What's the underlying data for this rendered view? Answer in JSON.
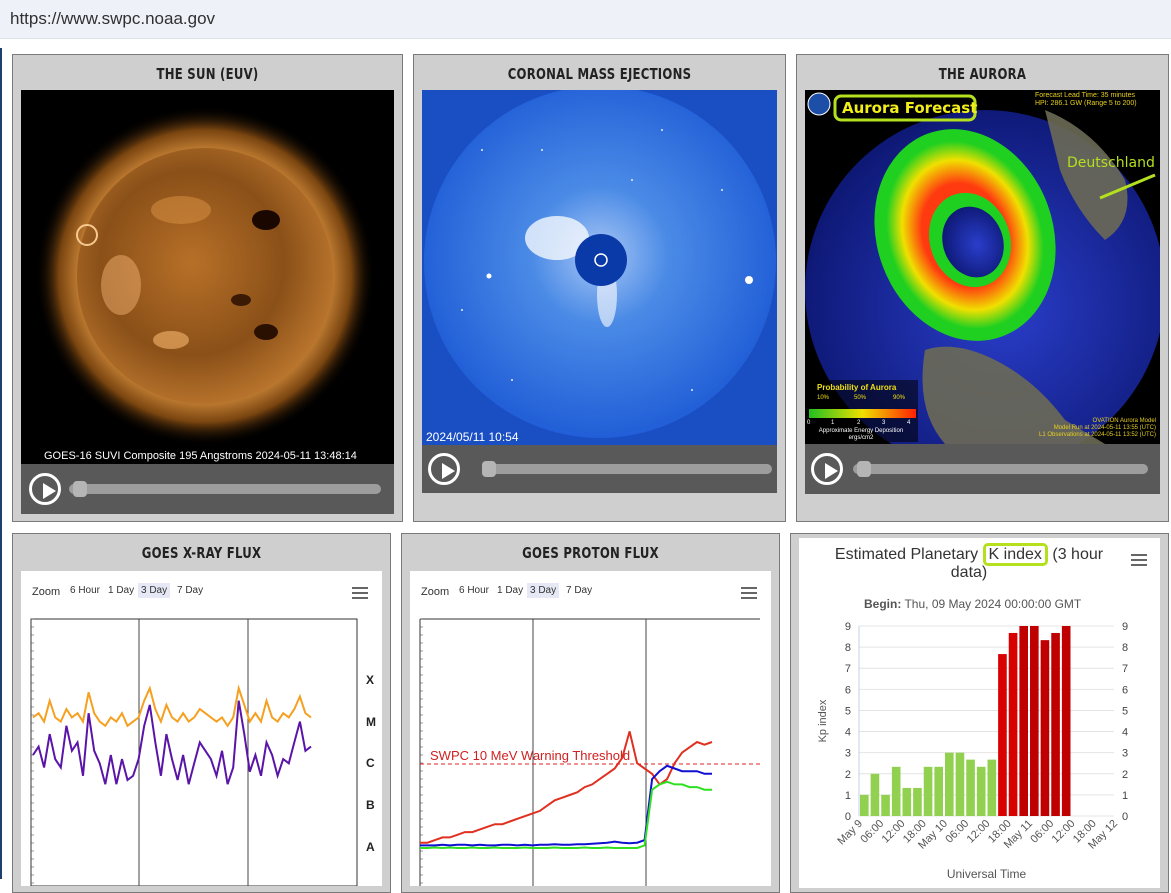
{
  "browser": {
    "url": "https://www.swpc.noaa.gov"
  },
  "panels": {
    "sun": {
      "title": "THE SUN (EUV)",
      "caption": "GOES-16 SUVI Composite 195 Angstroms 2024-05-11 13:48:14",
      "play_icon": "play-icon"
    },
    "cme": {
      "title": "CORONAL MASS EJECTIONS",
      "caption": "2024/05/11  10:54",
      "play_icon": "play-icon"
    },
    "aurora": {
      "title": "THE AURORA",
      "badge": "Aurora Forecast",
      "forecast_info": "Forecast Lead Time:  35 minutes",
      "hpi_info": "HPI: 286.1 GW (Range 5 to 200)",
      "country_label": "Deutschland",
      "legend_title": "Probability of Aurora",
      "legend_ticks": [
        "10%",
        "50%",
        "90%"
      ],
      "legend_scale": [
        "0",
        "1",
        "2",
        "3",
        "4"
      ],
      "legend_units": "Approximate Energy Deposition ergs/cm2",
      "model_info": "OVATION Aurora Model",
      "model_run": "Model Run at 2024-05-11 13:55 (UTC)",
      "obs_info": "L1 Observations at 2024-05-11 13:52 (UTC)",
      "play_icon": "play-icon"
    },
    "xray": {
      "title": "GOES X-RAY FLUX",
      "zoom_label": "Zoom",
      "zoom_options": [
        "6 Hour",
        "1 Day",
        "3 Day",
        "7 Day"
      ],
      "selected_zoom": "3 Day",
      "menu_icon": "hamburger-menu-icon",
      "class_labels": [
        "X",
        "M",
        "C",
        "B",
        "A"
      ]
    },
    "proton": {
      "title": "GOES PROTON FLUX",
      "zoom_label": "Zoom",
      "zoom_options": [
        "6 Hour",
        "1 Day",
        "3 Day",
        "7 Day"
      ],
      "selected_zoom": "3 Day",
      "menu_icon": "hamburger-menu-icon",
      "threshold_label": "SWPC 10 MeV Warning Threshold"
    },
    "kp": {
      "title_a": "Estimated Planetary",
      "title_b": "K index",
      "title_c": "(3 hour",
      "title_d": "data)",
      "menu_icon": "hamburger-menu-icon",
      "begin_label": "Begin:",
      "begin_value": "Thu, 09 May 2024 00:00:00 GMT"
    }
  },
  "chart_data": [
    {
      "type": "bar",
      "title": "Estimated Planetary K index (3 hour data)",
      "xlabel": "Universal Time",
      "ylabel": "Kp index",
      "ylim": [
        0,
        9
      ],
      "yticks": [
        "0",
        "1",
        "2",
        "3",
        "4",
        "5",
        "6",
        "7",
        "8",
        "9"
      ],
      "xticks": [
        "May 9",
        "06:00",
        "12:00",
        "18:00",
        "May 10",
        "06:00",
        "12:00",
        "18:00",
        "May 11",
        "06:00",
        "12:00",
        "18:00",
        "May 12"
      ],
      "values": [
        1,
        2,
        1,
        2.33,
        1.33,
        1.33,
        2.33,
        2.33,
        3,
        3,
        2.67,
        2.33,
        2.67,
        7.67,
        8.67,
        9,
        9,
        8.33,
        8.67,
        9
      ],
      "bar_colors": [
        "#92d050",
        "#92d050",
        "#92d050",
        "#92d050",
        "#92d050",
        "#92d050",
        "#92d050",
        "#92d050",
        "#92d050",
        "#92d050",
        "#92d050",
        "#92d050",
        "#92d050",
        "#d90000",
        "#d90000",
        "#c00000",
        "#c00000",
        "#c00000",
        "#c00000",
        "#c00000"
      ],
      "grid": true
    },
    {
      "type": "line",
      "title": "GOES X-RAY FLUX",
      "yticks": [
        "X",
        "M",
        "C",
        "B",
        "A"
      ],
      "series": [
        {
          "color": "#f5a020",
          "values": [
            3.2,
            3.3,
            3.1,
            3.6,
            3.2,
            3.1,
            3.4,
            3.2,
            3.3,
            3.1,
            3.8,
            3.3,
            3.1,
            3.0,
            3.2,
            3.1,
            3.3,
            3.0,
            3.1,
            3.2,
            3.6,
            3.9,
            3.4,
            3.1,
            3.5,
            3.2,
            3.1,
            3.3,
            3.1,
            3.2,
            3.4,
            3.3,
            3.2,
            3.1,
            3.2,
            3.0,
            3.2,
            3.9,
            3.5,
            3.1,
            3.3,
            3.1,
            3.6,
            3.2,
            3.1,
            3.3,
            3.2,
            3.4,
            3.7,
            3.3,
            3.2
          ]
        },
        {
          "color": "#5a14a8",
          "values": [
            2.3,
            2.5,
            2.0,
            2.8,
            2.2,
            2.0,
            3.0,
            2.4,
            2.6,
            1.8,
            3.3,
            2.4,
            2.1,
            1.6,
            2.3,
            1.6,
            2.2,
            1.7,
            1.8,
            2.2,
            3.0,
            3.5,
            2.6,
            1.8,
            2.8,
            2.2,
            1.7,
            2.3,
            1.6,
            2.1,
            2.6,
            2.4,
            2.2,
            1.8,
            2.4,
            1.6,
            2.0,
            3.6,
            2.8,
            1.9,
            2.3,
            1.8,
            2.6,
            2.3,
            1.8,
            2.2,
            2.1,
            2.6,
            3.1,
            2.4,
            2.5
          ]
        }
      ]
    },
    {
      "type": "line",
      "title": "GOES PROTON FLUX",
      "threshold": "SWPC 10 MeV Warning Threshold",
      "series": [
        {
          "color": "#e03020",
          "values": [
            0.1,
            0.1,
            0.15,
            0.2,
            0.2,
            0.25,
            0.3,
            0.3,
            0.35,
            0.4,
            0.45,
            0.45,
            0.5,
            0.55,
            0.6,
            0.65,
            0.7,
            0.8,
            0.9,
            0.95,
            1.0,
            1.05,
            1.15,
            1.2,
            1.3,
            1.4,
            1.5,
            1.7,
            2.2,
            1.6,
            1.5,
            1.4,
            1.2,
            1.3,
            1.6,
            1.8,
            1.9,
            2.0,
            1.95,
            2.0
          ]
        },
        {
          "color": "#1010d0",
          "values": [
            0.05,
            0.05,
            0.05,
            0.06,
            0.05,
            0.06,
            0.06,
            0.05,
            0.06,
            0.05,
            0.05,
            0.06,
            0.06,
            0.05,
            0.06,
            0.05,
            0.06,
            0.06,
            0.07,
            0.06,
            0.06,
            0.07,
            0.07,
            0.08,
            0.09,
            0.1,
            0.12,
            0.1,
            0.09,
            0.1,
            0.15,
            1.3,
            1.45,
            1.55,
            1.5,
            1.45,
            1.45,
            1.45,
            1.4,
            1.4
          ]
        },
        {
          "color": "#30e020",
          "values": [
            0.0,
            0.0,
            0.01,
            0.0,
            0.01,
            0.0,
            0.0,
            0.01,
            0.0,
            0.0,
            0.01,
            0.0,
            0.0,
            0.0,
            0.01,
            0.0,
            0.0,
            0.0,
            0.01,
            0.0,
            0.0,
            0.0,
            0.01,
            0.0,
            0.0,
            0.01,
            0.0,
            0.0,
            0.0,
            0.0,
            0.05,
            1.1,
            1.2,
            1.25,
            1.2,
            1.2,
            1.15,
            1.15,
            1.1,
            1.1
          ]
        }
      ]
    }
  ]
}
